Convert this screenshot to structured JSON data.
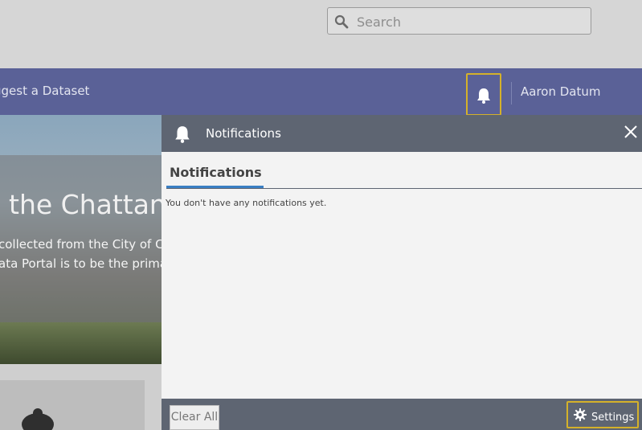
{
  "search": {
    "placeholder": "Search"
  },
  "nav": {
    "suggest_label": "ggest a Dataset",
    "user_name": "Aaron Datum"
  },
  "hero": {
    "title": "the Chattan",
    "line1": "collected from the City of Cl",
    "line2": "ata Portal is to be the prima"
  },
  "notifications": {
    "header_title": "Notifications",
    "tab_label": "Notifications",
    "empty_message": "You don't have any notifications yet.",
    "clear_all_label": "Clear All",
    "settings_label": "Settings"
  },
  "icons": {
    "search": "search-icon",
    "bell": "bell-icon",
    "close": "close-icon",
    "gear": "gear-icon"
  },
  "colors": {
    "nav": "#5a6197",
    "panel_header": "#5e6572",
    "highlight": "#d4b12a",
    "tab_accent": "#3a7fc4"
  }
}
